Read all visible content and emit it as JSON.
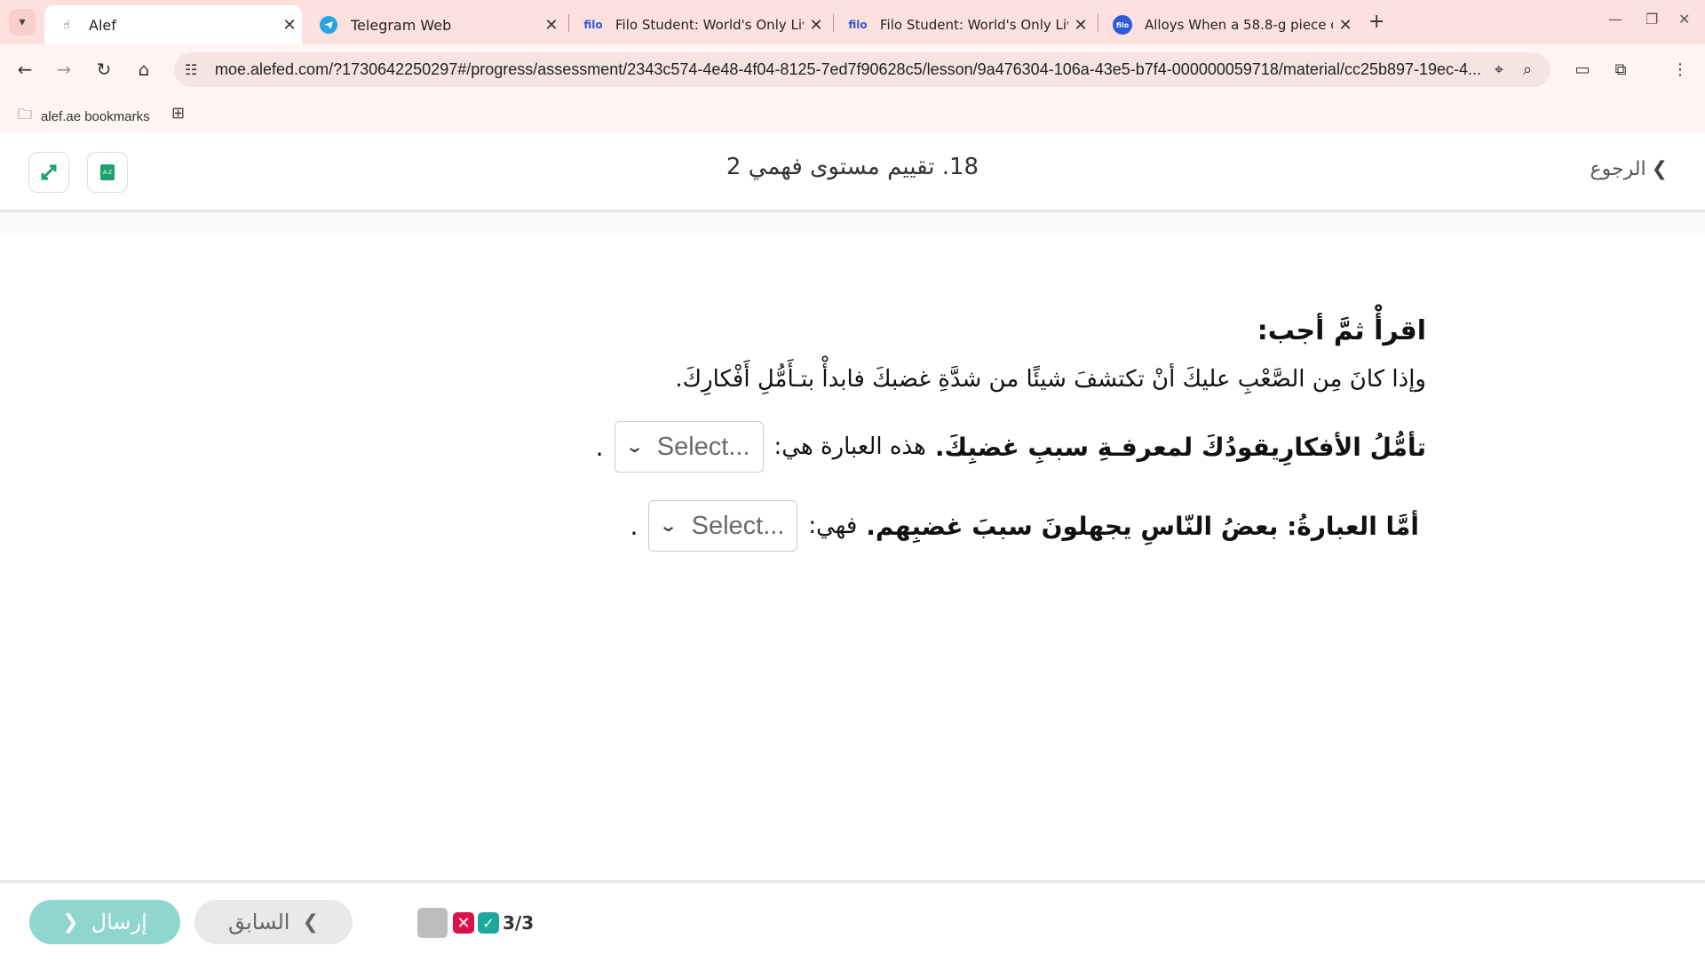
{
  "browser": {
    "tabs": [
      {
        "label": "Alef",
        "favicon": "hand"
      },
      {
        "label": "Telegram Web",
        "favicon": "telegram"
      },
      {
        "label": "Filo Student: World's Only Live I",
        "favicon": "filo"
      },
      {
        "label": "Filo Student: World's Only Live I",
        "favicon": "filo"
      },
      {
        "label": "Alloys When a 58.8-g piece of h",
        "favicon": "filo"
      }
    ],
    "url": "moe.alefed.com/?1730642250297#/progress/assessment/2343c574-4e48-4f04-8125-7ed7f90628c5/lesson/9a476304-106a-43e5-b7f4-000000059718/material/cc25b897-19ec-4...",
    "bookmark_label": "alef.ae bookmarks"
  },
  "header": {
    "title": "18. تقييم مستوى فهمي 2",
    "back_label": "الرجوع"
  },
  "question": {
    "instruction": "اقرأْ ثمَّ أجب:",
    "passage": "وإذا كانَ مِن الصَّعْبِ عليكَ أنْ تكتشفَ شيئًا من شدَّةِ غضبكَ فابدأْ بتـأَمُّلِ أَفْكارِكَ.",
    "line1_bold": "تأمُّلُ الأفكارِيقودُكَ لمعرفـةِ سببِ غضبِكَ.",
    "line1_tail": "هذه العبارة هي:",
    "line2_bold": "أمَّا العبارةُ: بعضُ النّاسِ يجهلونَ سببَ غضبِهم.",
    "line2_tail": "فهي:",
    "select_placeholder": "Select...",
    "period": "."
  },
  "footer": {
    "submit_label": "إرسال",
    "previous_label": "السابق",
    "progress_count": "3/3"
  }
}
